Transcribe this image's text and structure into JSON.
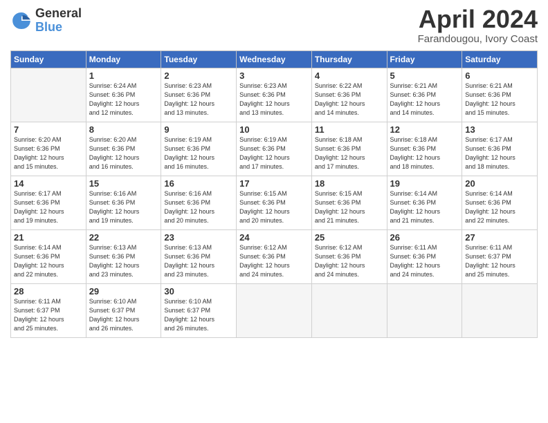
{
  "logo": {
    "general": "General",
    "blue": "Blue"
  },
  "title": "April 2024",
  "subtitle": "Farandougou, Ivory Coast",
  "headers": [
    "Sunday",
    "Monday",
    "Tuesday",
    "Wednesday",
    "Thursday",
    "Friday",
    "Saturday"
  ],
  "weeks": [
    [
      {
        "day": "",
        "info": ""
      },
      {
        "day": "1",
        "info": "Sunrise: 6:24 AM\nSunset: 6:36 PM\nDaylight: 12 hours\nand 12 minutes."
      },
      {
        "day": "2",
        "info": "Sunrise: 6:23 AM\nSunset: 6:36 PM\nDaylight: 12 hours\nand 13 minutes."
      },
      {
        "day": "3",
        "info": "Sunrise: 6:23 AM\nSunset: 6:36 PM\nDaylight: 12 hours\nand 13 minutes."
      },
      {
        "day": "4",
        "info": "Sunrise: 6:22 AM\nSunset: 6:36 PM\nDaylight: 12 hours\nand 14 minutes."
      },
      {
        "day": "5",
        "info": "Sunrise: 6:21 AM\nSunset: 6:36 PM\nDaylight: 12 hours\nand 14 minutes."
      },
      {
        "day": "6",
        "info": "Sunrise: 6:21 AM\nSunset: 6:36 PM\nDaylight: 12 hours\nand 15 minutes."
      }
    ],
    [
      {
        "day": "7",
        "info": "Sunrise: 6:20 AM\nSunset: 6:36 PM\nDaylight: 12 hours\nand 15 minutes."
      },
      {
        "day": "8",
        "info": "Sunrise: 6:20 AM\nSunset: 6:36 PM\nDaylight: 12 hours\nand 16 minutes."
      },
      {
        "day": "9",
        "info": "Sunrise: 6:19 AM\nSunset: 6:36 PM\nDaylight: 12 hours\nand 16 minutes."
      },
      {
        "day": "10",
        "info": "Sunrise: 6:19 AM\nSunset: 6:36 PM\nDaylight: 12 hours\nand 17 minutes."
      },
      {
        "day": "11",
        "info": "Sunrise: 6:18 AM\nSunset: 6:36 PM\nDaylight: 12 hours\nand 17 minutes."
      },
      {
        "day": "12",
        "info": "Sunrise: 6:18 AM\nSunset: 6:36 PM\nDaylight: 12 hours\nand 18 minutes."
      },
      {
        "day": "13",
        "info": "Sunrise: 6:17 AM\nSunset: 6:36 PM\nDaylight: 12 hours\nand 18 minutes."
      }
    ],
    [
      {
        "day": "14",
        "info": "Sunrise: 6:17 AM\nSunset: 6:36 PM\nDaylight: 12 hours\nand 19 minutes."
      },
      {
        "day": "15",
        "info": "Sunrise: 6:16 AM\nSunset: 6:36 PM\nDaylight: 12 hours\nand 19 minutes."
      },
      {
        "day": "16",
        "info": "Sunrise: 6:16 AM\nSunset: 6:36 PM\nDaylight: 12 hours\nand 20 minutes."
      },
      {
        "day": "17",
        "info": "Sunrise: 6:15 AM\nSunset: 6:36 PM\nDaylight: 12 hours\nand 20 minutes."
      },
      {
        "day": "18",
        "info": "Sunrise: 6:15 AM\nSunset: 6:36 PM\nDaylight: 12 hours\nand 21 minutes."
      },
      {
        "day": "19",
        "info": "Sunrise: 6:14 AM\nSunset: 6:36 PM\nDaylight: 12 hours\nand 21 minutes."
      },
      {
        "day": "20",
        "info": "Sunrise: 6:14 AM\nSunset: 6:36 PM\nDaylight: 12 hours\nand 22 minutes."
      }
    ],
    [
      {
        "day": "21",
        "info": "Sunrise: 6:14 AM\nSunset: 6:36 PM\nDaylight: 12 hours\nand 22 minutes."
      },
      {
        "day": "22",
        "info": "Sunrise: 6:13 AM\nSunset: 6:36 PM\nDaylight: 12 hours\nand 23 minutes."
      },
      {
        "day": "23",
        "info": "Sunrise: 6:13 AM\nSunset: 6:36 PM\nDaylight: 12 hours\nand 23 minutes."
      },
      {
        "day": "24",
        "info": "Sunrise: 6:12 AM\nSunset: 6:36 PM\nDaylight: 12 hours\nand 24 minutes."
      },
      {
        "day": "25",
        "info": "Sunrise: 6:12 AM\nSunset: 6:36 PM\nDaylight: 12 hours\nand 24 minutes."
      },
      {
        "day": "26",
        "info": "Sunrise: 6:11 AM\nSunset: 6:36 PM\nDaylight: 12 hours\nand 24 minutes."
      },
      {
        "day": "27",
        "info": "Sunrise: 6:11 AM\nSunset: 6:37 PM\nDaylight: 12 hours\nand 25 minutes."
      }
    ],
    [
      {
        "day": "28",
        "info": "Sunrise: 6:11 AM\nSunset: 6:37 PM\nDaylight: 12 hours\nand 25 minutes."
      },
      {
        "day": "29",
        "info": "Sunrise: 6:10 AM\nSunset: 6:37 PM\nDaylight: 12 hours\nand 26 minutes."
      },
      {
        "day": "30",
        "info": "Sunrise: 6:10 AM\nSunset: 6:37 PM\nDaylight: 12 hours\nand 26 minutes."
      },
      {
        "day": "",
        "info": ""
      },
      {
        "day": "",
        "info": ""
      },
      {
        "day": "",
        "info": ""
      },
      {
        "day": "",
        "info": ""
      }
    ]
  ]
}
